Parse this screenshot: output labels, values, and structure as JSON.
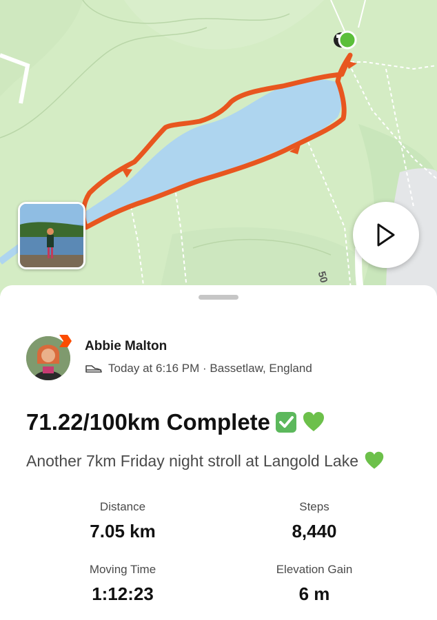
{
  "map": {
    "road_label": "50",
    "route_color": "#e8561f",
    "lake_color": "#aed5ef",
    "start_marker_color": "#5bbf3a"
  },
  "activity": {
    "athlete_name": "Abbie Malton",
    "activity_icon": "walking-shoe-icon",
    "meta": "Today at 6:16 PM · Bassetlaw, England",
    "title": "71.22/100km Complete",
    "title_emojis": [
      "check-mark-button-icon",
      "green-heart-icon"
    ],
    "description": "Another 7km Friday night stroll at Langold Lake",
    "description_emoji": "green-heart-icon"
  },
  "stats": [
    {
      "label": "Distance",
      "value": "7.05 km"
    },
    {
      "label": "Steps",
      "value": "8,440"
    },
    {
      "label": "Moving Time",
      "value": "1:12:23"
    },
    {
      "label": "Elevation Gain",
      "value": "6 m"
    }
  ],
  "colors": {
    "brand_orange": "#fc4c02",
    "check_green": "#5cb85c",
    "heart_green": "#6cc04a"
  }
}
